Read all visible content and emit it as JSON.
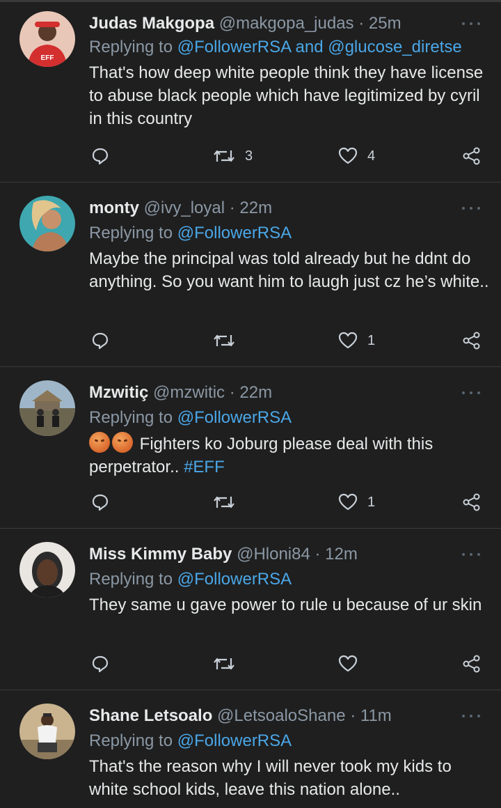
{
  "tweets": [
    {
      "name": "Judas Makgopa",
      "handle": "@makgopa_judas",
      "time": "25m",
      "replying_prefix": "Replying to ",
      "mentions": "@FollowerRSA and @glucose_diretse",
      "text": "That's how deep white people think they have license to abuse black people which have legitimized by cyril in this country",
      "retweets": "3",
      "likes": "4",
      "avatar_color": "#c62828"
    },
    {
      "name": "monty",
      "handle": "@ivy_loyal",
      "time": "22m",
      "replying_prefix": "Replying to ",
      "mentions": "@FollowerRSA",
      "text": "Maybe the principal was told already but he ddnt do anything.  So you want him to laugh just cz he’s white..",
      "retweets": "",
      "likes": "1",
      "avatar_color": "#3fa7b0"
    },
    {
      "name": "Mzwitiç",
      "handle": "@mzwitic",
      "time": "22m",
      "replying_prefix": "Replying to ",
      "mentions": "@FollowerRSA",
      "text_after_emoji": " Fighters ko Joburg please deal with this perpetrator.. ",
      "hashtag": "#EFF",
      "retweets": "",
      "likes": "1",
      "avatar_color": "#6d7b6a"
    },
    {
      "name": "Miss Kimmy Baby",
      "handle": "@Hloni84",
      "time": "12m",
      "replying_prefix": "Replying to ",
      "mentions": "@FollowerRSA",
      "text": "They same u gave power to rule u because of ur skin",
      "retweets": "",
      "likes": "",
      "avatar_color": "#5a5a5a"
    },
    {
      "name": "Shane Letsoalo",
      "handle": "@LetsoaloShane",
      "time": "11m",
      "replying_prefix": "Replying to ",
      "mentions": "@FollowerRSA",
      "text": "That's the reason why I will never took my kids to white school kids, leave this nation alone..",
      "retweets": "",
      "likes": "",
      "avatar_color": "#b8a07a"
    }
  ],
  "icons": {
    "reply": "reply-icon",
    "retweet": "retweet-icon",
    "like": "heart-icon",
    "share": "share-icon",
    "more": "more-icon"
  },
  "colors": {
    "background": "#1f1f1f",
    "link": "#4aa7e8",
    "secondary": "#8b98a5"
  }
}
